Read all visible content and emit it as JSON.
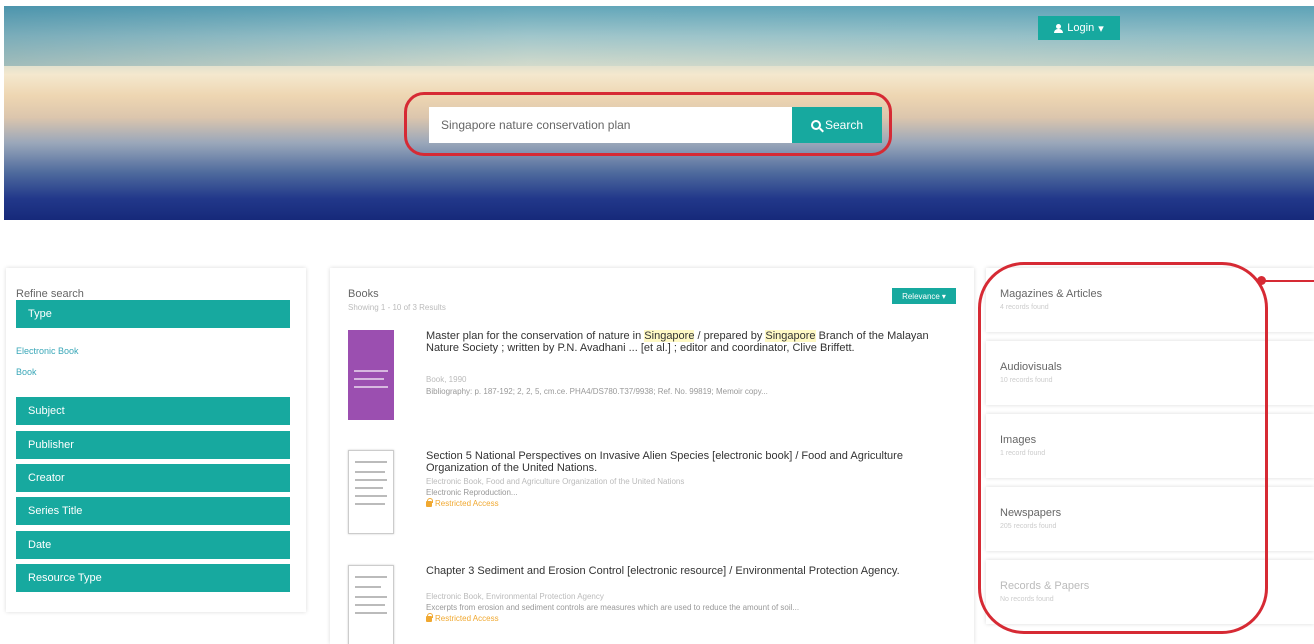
{
  "header": {
    "login_label": "Login",
    "search": {
      "value": "Singapore nature conservation plan",
      "button_label": "Search"
    }
  },
  "refine": {
    "title": "Refine search",
    "type_label": "Type",
    "type_options": [
      "Electronic Book",
      "Book"
    ],
    "facets": [
      "Subject",
      "Publisher",
      "Creator",
      "Series Title",
      "Date",
      "Resource Type"
    ]
  },
  "books": {
    "title": "Books",
    "subtitle": "Showing 1 - 10 of 3 Results",
    "sort_label": "Relevance",
    "results": [
      {
        "title_parts": [
          "Master plan for the conservation of nature in ",
          "Singapore",
          " / prepared by ",
          "Singapore",
          " Branch of the Malayan Nature Society ; written by P.N. Avadhani ... [et al.] ; editor and coordinator, Clive Briffett."
        ],
        "meta": "Book, 1990",
        "desc": "Bibliography: p. 187-192; 2, 2, 5, cm.ce. PHA4/DS780.T37/9938; Ref. No. 99819; Memoir copy..."
      },
      {
        "title": "Section 5 National Perspectives on Invasive Alien Species [electronic book] / Food and Agriculture Organization of the United Nations.",
        "meta": "Electronic Book, Food and Agriculture Organization of the United Nations",
        "desc": "Electronic Reproduction...",
        "avail": "Restricted Access"
      },
      {
        "title": "Chapter 3 Sediment and Erosion Control [electronic resource] / Environmental Protection Agency.",
        "meta": "Electronic Book, Environmental Protection Agency",
        "desc": "Excerpts from erosion and sediment controls are measures which are used to reduce the amount of soil...",
        "avail": "Restricted Access"
      }
    ]
  },
  "categories": [
    {
      "name": "Magazines & Articles",
      "count": "4 records found"
    },
    {
      "name": "Audiovisuals",
      "count": "10 records found"
    },
    {
      "name": "Images",
      "count": "1 record found"
    },
    {
      "name": "Newspapers",
      "count": "205 records found"
    },
    {
      "name": "Records & Papers",
      "count": "No records found"
    }
  ],
  "colors": {
    "accent": "#17a99f",
    "highlight": "#d62a34"
  }
}
